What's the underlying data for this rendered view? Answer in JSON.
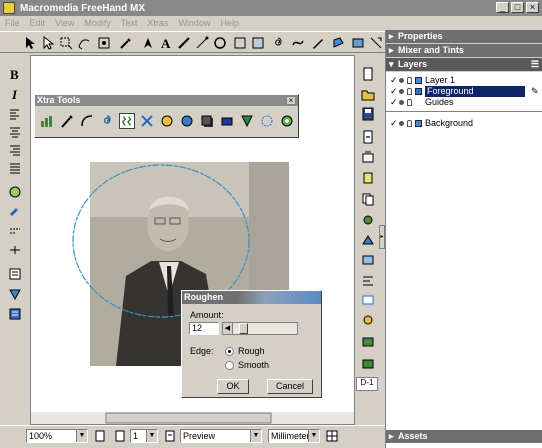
{
  "window": {
    "title": "Macromedia FreeHand MX",
    "min_glyph": "_",
    "max_glyph": "□",
    "close_glyph": "×"
  },
  "menu": [
    "File",
    "Edit",
    "View",
    "Modify",
    "Text",
    "Xtras",
    "Window",
    "Help"
  ],
  "panels": {
    "properties": "Properties",
    "mixer": "Mixer and Tints",
    "layers": "Layers",
    "assets": "Assets",
    "layer_items": [
      {
        "name": "Layer 1",
        "color": "#4a8ad0",
        "selected": false
      },
      {
        "name": "Foreground",
        "color": "#3070c0",
        "selected": true
      },
      {
        "name": "Guides",
        "color": "#ffffff",
        "selected": false
      },
      {
        "name": "Background",
        "color": "#4a8ad0",
        "selected": false
      }
    ]
  },
  "xtra_tools": {
    "title": "Xtra Tools",
    "close_glyph": "×"
  },
  "roughen": {
    "title": "Roughen",
    "amount_label": "Amount:",
    "amount_value": "12",
    "edge_label": "Edge:",
    "rough_label": "Rough",
    "smooth_label": "Smooth",
    "ok_label": "OK",
    "cancel_label": "Cancel",
    "edge_selected": "Rough"
  },
  "statusbar": {
    "zoom": "100%",
    "page": "1",
    "view_mode": "Preview",
    "units": "Millimeters"
  },
  "page_indicator": "D-1",
  "colors": {
    "selection": "#10246a",
    "path_circle": "#3a90c0",
    "title_active": "#5a8ac8"
  }
}
